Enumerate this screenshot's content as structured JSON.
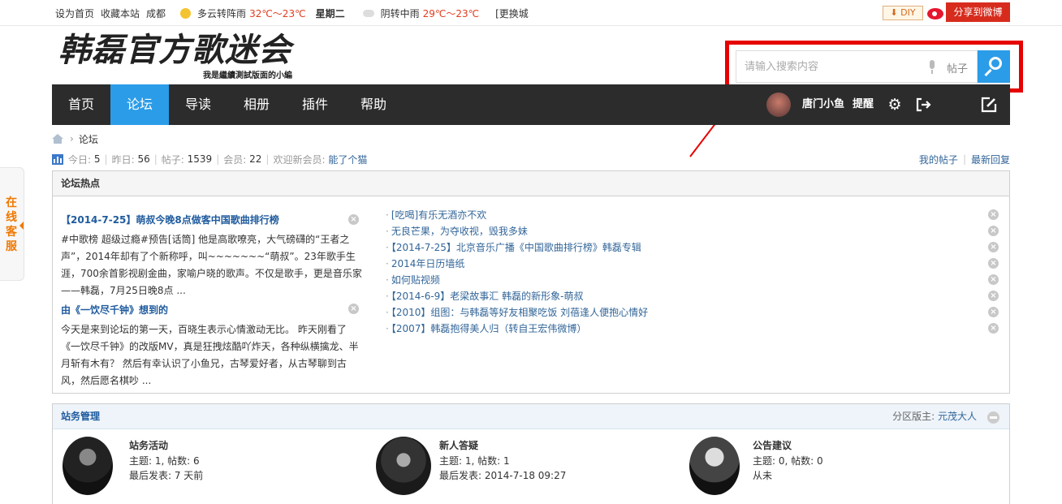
{
  "topbar": {
    "set_home": "设为首页",
    "bookmark": "收藏本站",
    "city": "成都",
    "weather_today": "多云转阵雨",
    "temp_today": "32℃～23℃",
    "weekday": "星期二",
    "weather_tomorrow": "阴转中雨",
    "temp_tomorrow": "29℃～23℃",
    "change_city": "[更换城",
    "diy": "DIY",
    "share_weibo": "分享到微博"
  },
  "logo": {
    "title": "韩磊官方歌迷会",
    "subtitle": "我是繼續測試版面的小編"
  },
  "search": {
    "placeholder": "请输入搜索内容",
    "type": "帖子"
  },
  "nav": {
    "items": [
      "首页",
      "论坛",
      "导读",
      "相册",
      "插件",
      "帮助"
    ],
    "active": "论坛",
    "username": "唐门小鱼",
    "remind": "提醒"
  },
  "breadcrumb": {
    "current": "论坛"
  },
  "stats": {
    "today_label": "今日:",
    "today": "5",
    "yesterday_label": "昨日:",
    "yesterday": "56",
    "posts_label": "帖子:",
    "posts": "1539",
    "members_label": "会员:",
    "members": "22",
    "welcome_label": "欢迎新会员:",
    "newest_member": "能了个猫",
    "my_posts": "我的帖子",
    "latest_replies": "最新回复"
  },
  "hot": {
    "title": "论坛热点",
    "articles": [
      {
        "title": "【2014-7-25】萌叔今晚8点做客中国歌曲排行榜",
        "desc": "#中歌榜 超级过瘾#预告[话筒] 他是高歌嘹亮，大气磅礴的“王者之声”，2014年却有了个新称呼，叫~~~~~~~“萌叔”。23年歌手生涯，700余首影视剧金曲，家喻户晓的歌声。不仅是歌手，更是音乐家——韩磊，7月25日晚8点 ..."
      },
      {
        "title": "由《一饮尽千钟》想到的",
        "desc": "今天是来到论坛的第一天，百晓生表示心情激动无比。 昨天刚看了《一饮尽千钟》的改版MV，真是狂拽炫酷吖炸天，各种纵横擒龙、半月斩有木有？ 然后有幸认识了小鱼兄，古琴爱好者，从古琴聊到古风，然后愿名棋吵 ..."
      }
    ],
    "list": [
      "[吃喝]有乐无酒亦不欢",
      "无良芒果，为夺收视，毁我多妹",
      "【2014-7-25】北京音乐广播《中国歌曲排行榜》韩磊专辑",
      "2014年日历墙纸",
      "如何贴视频",
      "【2014-6-9】老梁故事汇 韩磊的新形象-萌叔",
      "【2010】组图：与韩磊等好友相聚吃饭 刘蓓逢人便抱心情好",
      "【2007】韩磊抱得美人归（转自王宏伟微博）"
    ]
  },
  "admin": {
    "title": "站务管理",
    "moderator_label": "分区版主:",
    "moderator": "元茂大人",
    "forums": [
      {
        "name": "站务活动",
        "stats": "主题: 1, 帖数: 6",
        "last": "最后发表: 7 天前"
      },
      {
        "name": "新人答疑",
        "stats": "主题: 1, 帖数: 1",
        "last": "最后发表: 2014-7-18 09:27"
      },
      {
        "name": "公告建议",
        "stats": "主题: 0, 帖数: 0",
        "last": "从未"
      }
    ]
  },
  "online_service": "在线客服"
}
